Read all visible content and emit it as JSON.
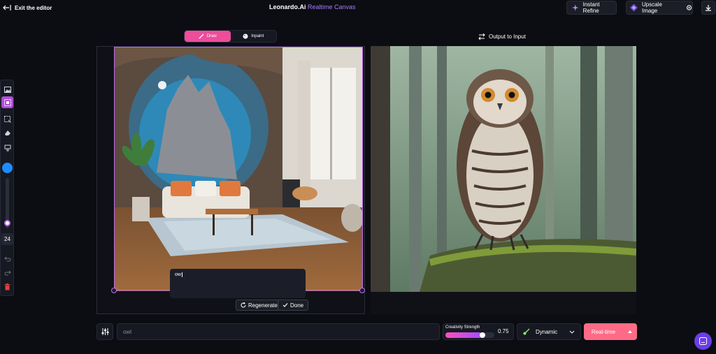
{
  "header": {
    "exit_label": "Exit the editor",
    "title_main": "Leonardo.Ai",
    "title_accent": "Realtime Canvas",
    "instant_refine": "Instant Refine",
    "upscale_image": "Upscale Image"
  },
  "tabs": [
    {
      "label": "Draw",
      "active": true
    },
    {
      "label": "Inpaint",
      "active": false
    }
  ],
  "output_to_input": "Output to Input",
  "toolbar": {
    "brush_size": "24",
    "brush_color": "#1e8cff",
    "tools": [
      "image-icon",
      "grid-select-icon",
      "selection-icon",
      "eraser-icon",
      "paint-bucket-icon"
    ]
  },
  "canvas": {
    "prompt_text": "ow",
    "regenerate_label": "Regenerate",
    "done_label": "Done"
  },
  "bottom": {
    "prompt_value": "owl",
    "creativity_label": "Creativity Strength",
    "creativity_value": "0.75",
    "creativity_fraction": 0.75,
    "style_value": "Dynamic",
    "realtime_label": "Real-time"
  },
  "colors": {
    "accent_pink": "#ee4d9b",
    "selection_purple": "#c06cf0",
    "realtime_button": "#ff6b86",
    "chat_bubble": "#6a3ee6"
  }
}
